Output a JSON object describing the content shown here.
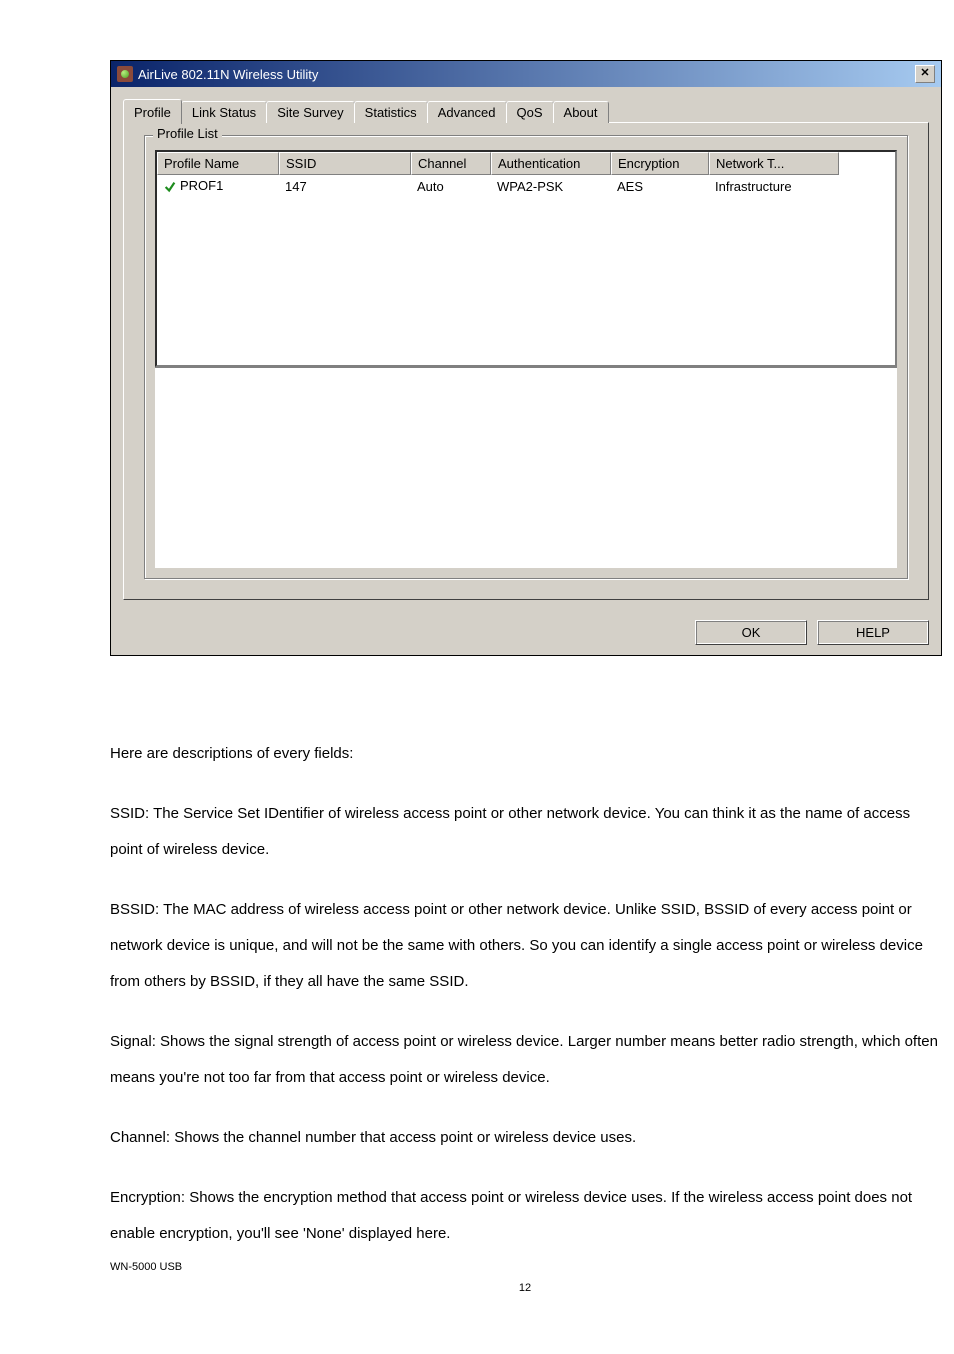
{
  "window": {
    "title": "AirLive 802.11N  Wireless Utility"
  },
  "tabs": [
    "Profile",
    "Link Status",
    "Site Survey",
    "Statistics",
    "Advanced",
    "QoS",
    "About"
  ],
  "profile_list": {
    "legend": "Profile List",
    "columns": {
      "name": "Profile Name",
      "ssid": "SSID",
      "channel": "Channel",
      "auth": "Authentication",
      "enc": "Encryption",
      "net": "Network T..."
    },
    "rows": [
      {
        "name": "PROF1",
        "ssid": "147",
        "channel": "Auto",
        "auth": "WPA2-PSK",
        "enc": "AES",
        "net": "Infrastructure"
      }
    ]
  },
  "buttons": {
    "ok": "OK",
    "help": "HELP"
  },
  "doc": {
    "intro": "Here are descriptions of every fields:",
    "ssid": "SSID: The Service Set IDentifier of wireless access point or other network device. You can think it as the name of access point of wireless device.",
    "bssid": "BSSID: The MAC address of wireless access point or other network device. Unlike SSID, BSSID of every access point or network device is unique, and will not be the same with others. So you can identify a single access point or wireless device from others by BSSID, if they all have the same SSID.",
    "signal": "Signal: Shows the signal strength of access point or wireless device. Larger number means better radio strength, which often means you're not too far from that access point or wireless device.",
    "channel": "Channel: Shows the channel number that access point or wireless device uses.",
    "encryption": "Encryption: Shows the encryption method that access point or wireless device uses. If the wireless access point does not enable encryption, you'll see 'None' displayed here.",
    "footer": "WN-5000 USB",
    "page": "12"
  }
}
